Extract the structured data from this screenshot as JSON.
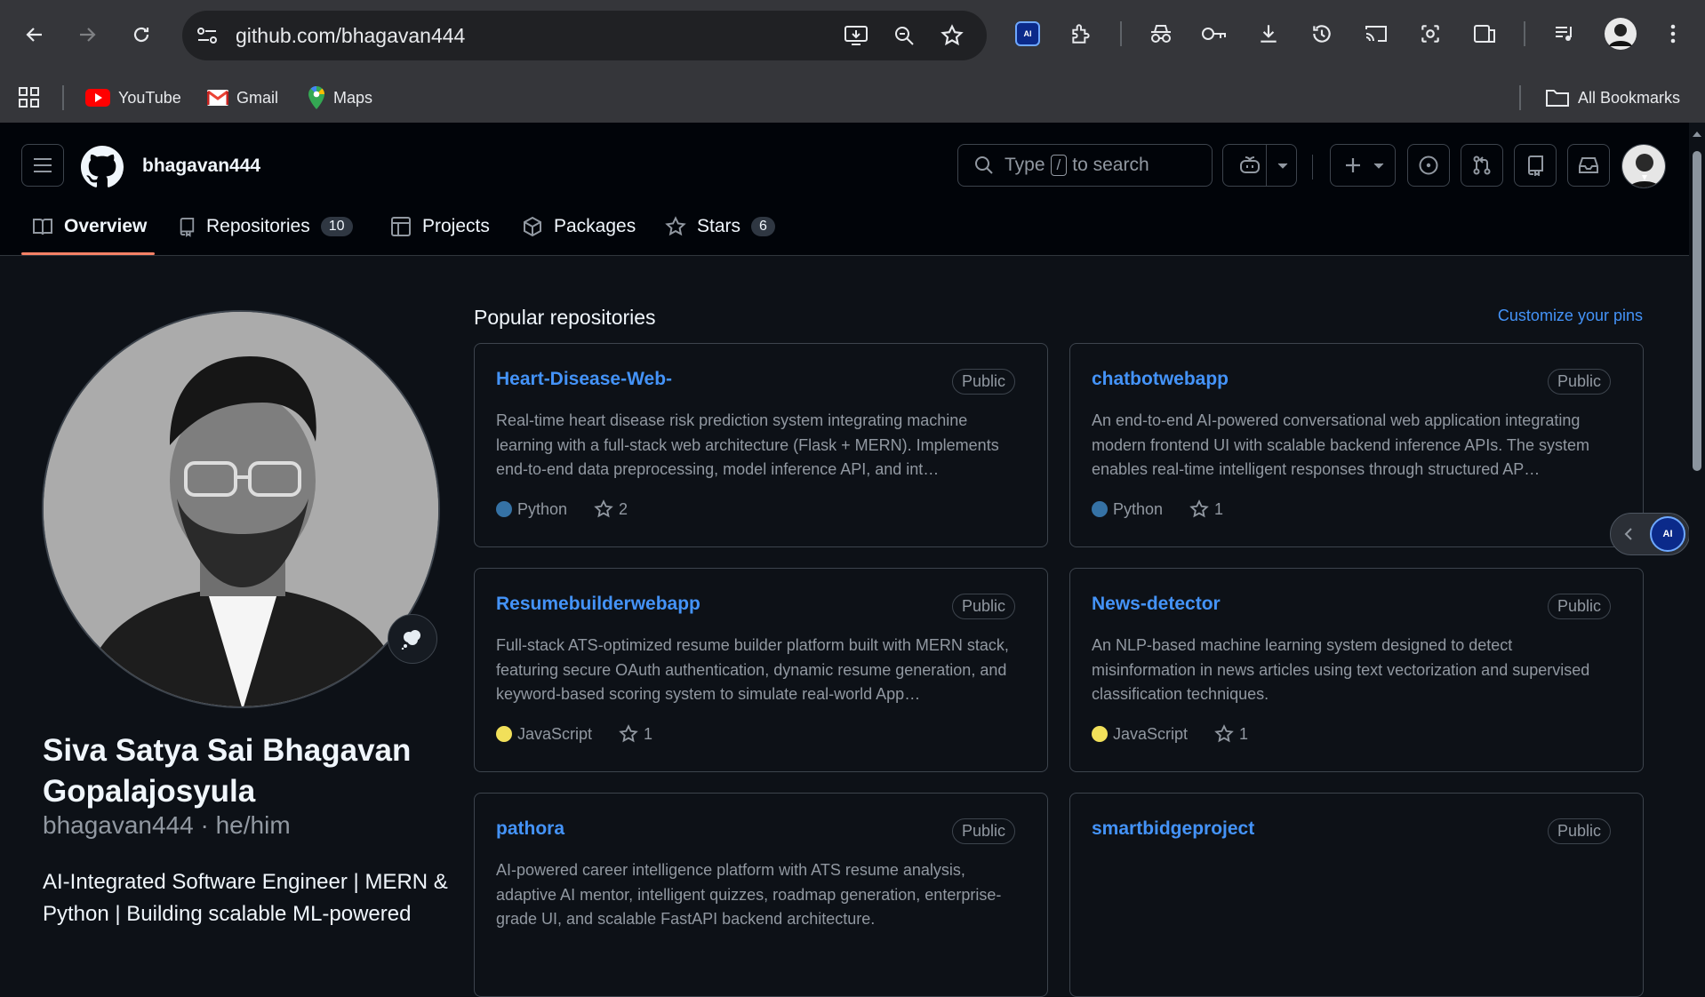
{
  "browser": {
    "url": "github.com/bhagavan444",
    "bookmarks": [
      {
        "label": "YouTube",
        "icon": "youtube-icon"
      },
      {
        "label": "Gmail",
        "icon": "gmail-icon"
      },
      {
        "label": "Maps",
        "icon": "maps-icon"
      }
    ],
    "all_bookmarks": "All Bookmarks",
    "extension_badge": "AI"
  },
  "header": {
    "username": "bhagavan444",
    "search_prefix": "Type",
    "search_key": "/",
    "search_suffix": "to search"
  },
  "tabs": [
    {
      "label": "Overview",
      "count": null
    },
    {
      "label": "Repositories",
      "count": "10"
    },
    {
      "label": "Projects",
      "count": null
    },
    {
      "label": "Packages",
      "count": null
    },
    {
      "label": "Stars",
      "count": "6"
    }
  ],
  "profile": {
    "name": "Siva Satya Sai Bhagavan Gopalajosyula",
    "login_line": "bhagavan444 · he/him",
    "bio": "AI-Integrated Software Engineer | MERN & Python | Building scalable ML-powered"
  },
  "pins": {
    "title": "Popular repositories",
    "customize": "Customize your pins",
    "repos": [
      {
        "name": "Heart-Disease-Web-",
        "visibility": "Public",
        "description": "Real-time heart disease risk prediction system integrating machine learning with a full-stack web architecture (Flask + MERN). Implements end-to-end data preprocessing, model inference API, and int…",
        "language": "Python",
        "lang_color": "#3572A5",
        "stars": "2"
      },
      {
        "name": "chatbotwebapp",
        "visibility": "Public",
        "description": "An end-to-end AI-powered conversational web application integrating modern frontend UI with scalable backend inference APIs. The system enables real-time intelligent responses through structured AP…",
        "language": "Python",
        "lang_color": "#3572A5",
        "stars": "1"
      },
      {
        "name": "Resumebuilderwebapp",
        "visibility": "Public",
        "description": "Full-stack ATS-optimized resume builder platform built with MERN stack, featuring secure OAuth authentication, dynamic resume generation, and keyword-based scoring system to simulate real-world App…",
        "language": "JavaScript",
        "lang_color": "#f1e05a",
        "stars": "1"
      },
      {
        "name": "News-detector",
        "visibility": "Public",
        "description": "An NLP-based machine learning system designed to detect misinformation in news articles using text vectorization and supervised classification techniques.",
        "language": "JavaScript",
        "lang_color": "#f1e05a",
        "stars": "1"
      },
      {
        "name": "pathora",
        "visibility": "Public",
        "description": "AI-powered career intelligence platform with ATS resume analysis, adaptive AI mentor, intelligent quizzes, roadmap generation, enterprise-grade UI, and scalable FastAPI backend architecture.",
        "language": "",
        "lang_color": "",
        "stars": ""
      },
      {
        "name": "smartbidgeproject",
        "visibility": "Public",
        "description": "",
        "language": "",
        "lang_color": "",
        "stars": ""
      }
    ]
  }
}
